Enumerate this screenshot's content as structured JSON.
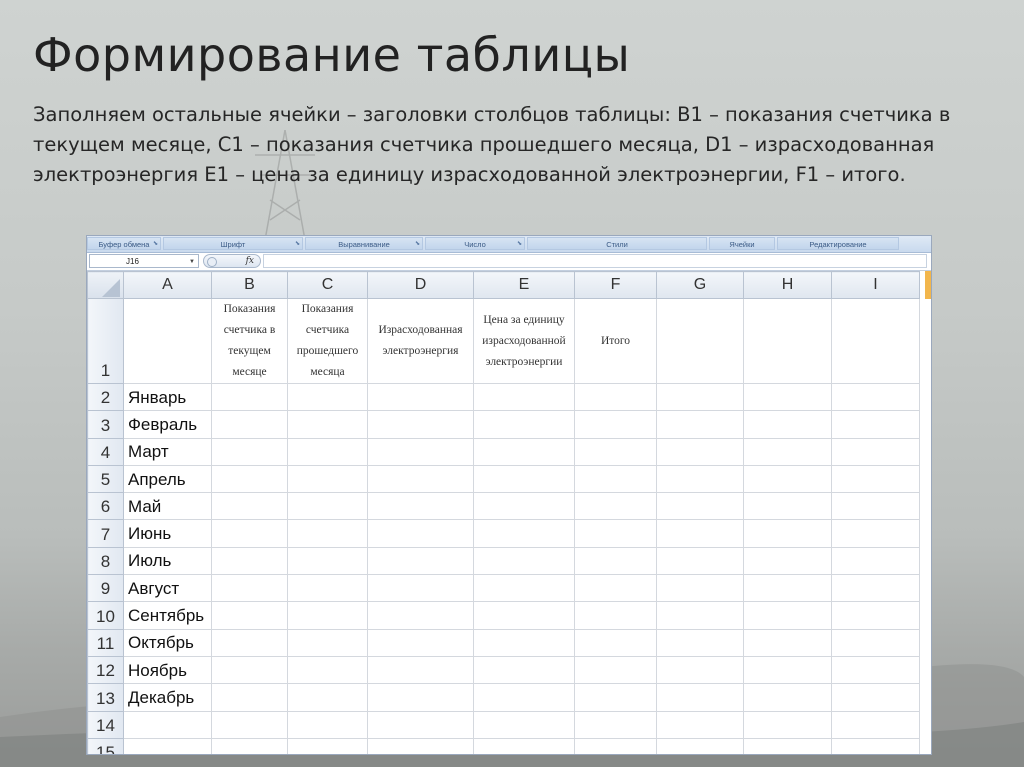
{
  "slide": {
    "title": "Формирование таблицы",
    "body": "Заполняем остальные ячейки – заголовки столбцов таблицы: В1 – показания счетчика в текущем месяце, С1 – показания счетчика прошедшего месяца, D1 – израсходованная электроэнергия Е1 – цена за единицу израсходованной электроэнергии, F1 – итого."
  },
  "ribbon": {
    "groups": [
      "Буфер обмена",
      "Шрифт",
      "Выравнивание",
      "Число",
      "Стили",
      "Ячейки",
      "Редактирование"
    ]
  },
  "formula_bar": {
    "name_box": "J16",
    "fx_label": "fx",
    "value": ""
  },
  "sheet": {
    "columns": [
      "A",
      "B",
      "C",
      "D",
      "E",
      "F",
      "G",
      "H",
      "I"
    ],
    "header_row_number": "1",
    "headers": {
      "B": "Показания\nсчетчика в\nтекущем\nмесяце",
      "C": "Показания\nсчетчика\nпрошедшего\nмесяца",
      "D": "Израсходованная\nэлектроэнергия",
      "E": "Цена за единицу\nизрасходованной\nэлектроэнергии",
      "F": "Итого"
    },
    "rows": [
      {
        "num": "2",
        "month": "Январь"
      },
      {
        "num": "3",
        "month": "Февраль"
      },
      {
        "num": "4",
        "month": "Март"
      },
      {
        "num": "5",
        "month": "Апрель"
      },
      {
        "num": "6",
        "month": "Май"
      },
      {
        "num": "7",
        "month": "Июнь"
      },
      {
        "num": "8",
        "month": "Июль"
      },
      {
        "num": "9",
        "month": "Август"
      },
      {
        "num": "10",
        "month": "Сентябрь"
      },
      {
        "num": "11",
        "month": "Октябрь"
      },
      {
        "num": "12",
        "month": "Ноябрь"
      },
      {
        "num": "13",
        "month": "Декабрь"
      },
      {
        "num": "14",
        "month": ""
      },
      {
        "num": "15",
        "month": ""
      }
    ]
  }
}
